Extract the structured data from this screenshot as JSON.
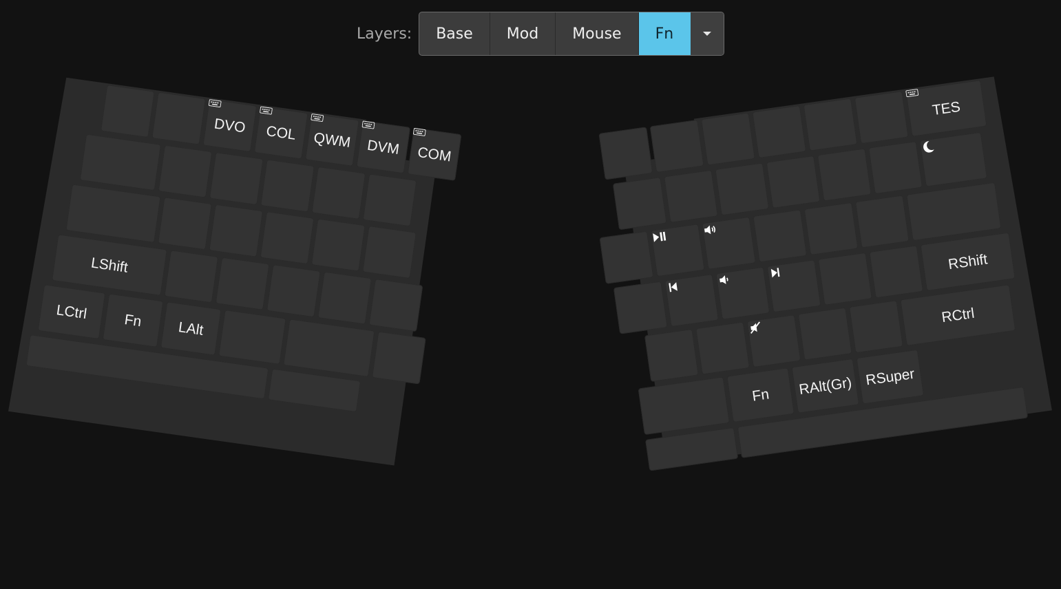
{
  "layers": {
    "label": "Layers:",
    "buttons": [
      "Base",
      "Mod",
      "Mouse",
      "Fn"
    ],
    "active": "Fn",
    "active_color": "#5bc5ea"
  },
  "left_half": {
    "row1": [
      "",
      "",
      "DVO",
      "COL",
      "QWM",
      "DVM",
      "COM"
    ],
    "row1_icons": [
      "",
      "",
      "keyboard-icon",
      "keyboard-icon",
      "keyboard-icon",
      "keyboard-icon",
      "keyboard-icon"
    ],
    "shift": "LShift",
    "bottom": [
      "LCtrl",
      "Fn",
      "LAlt"
    ]
  },
  "right_half": {
    "top_right": "TES",
    "top_right_icon": "keyboard-icon",
    "sleep_icon": "moon-icon",
    "media": {
      "play_pause": "play-pause-icon",
      "volume_up": "volume-up-icon",
      "previous": "previous-track-icon",
      "volume_down": "volume-down-icon",
      "next": "next-track-icon",
      "mute": "mute-icon"
    },
    "shift": "RShift",
    "ctrl": "RCtrl",
    "bottom": [
      "Fn",
      "RAlt(Gr)",
      "RSuper"
    ]
  },
  "colors": {
    "background": "#121212",
    "board": "#2b2b2b",
    "key": "#333333"
  }
}
